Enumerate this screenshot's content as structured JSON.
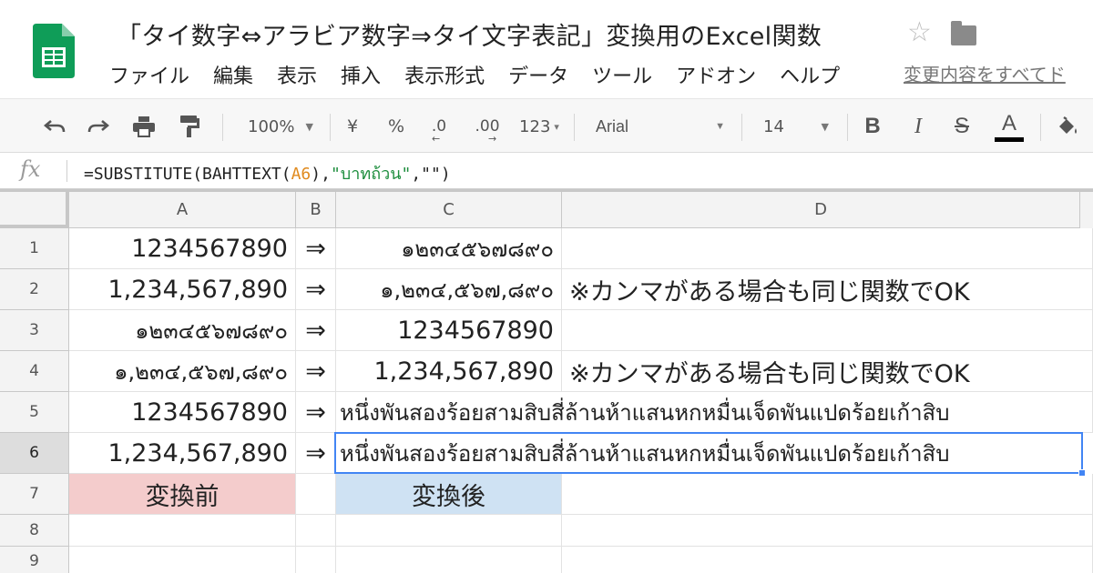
{
  "header": {
    "title": "「タイ数字⇔アラビア数字⇒タイ文字表記」変換用のExcel関数",
    "menu": [
      "ファイル",
      "編集",
      "表示",
      "挿入",
      "表示形式",
      "データ",
      "ツール",
      "アドオン",
      "ヘルプ"
    ],
    "last_edit": "変更内容をすべてド"
  },
  "toolbar": {
    "zoom": "100%",
    "currency": "¥",
    "percent": "%",
    "dec_decrease": ".0",
    "dec_increase": ".00",
    "number_format": "123",
    "font": "Arial",
    "font_size": "14",
    "bold": "B",
    "italic": "I",
    "strike": "S",
    "text_color": "A"
  },
  "formula_bar": {
    "fx": "fx",
    "prefix": "=SUBSTITUTE(BAHTTEXT(",
    "ref": "A6",
    "mid": "),",
    "str": "\"บาทถ้วน\"",
    "suffix": ",\"\")"
  },
  "columns": [
    "A",
    "B",
    "C",
    "D"
  ],
  "rows": [
    {
      "num": "1",
      "a": "1234567890",
      "b": "⇒",
      "c": "๑๒๓๔๕๖๗๘๙๐",
      "d": ""
    },
    {
      "num": "2",
      "a": "1,234,567,890",
      "b": "⇒",
      "c": "๑,๒๓๔,๕๖๗,๘๙๐",
      "d": "※カンマがある場合も同じ関数でOK"
    },
    {
      "num": "3",
      "a": "๑๒๓๔๕๖๗๘๙๐",
      "b": "⇒",
      "c": "1234567890",
      "d": ""
    },
    {
      "num": "4",
      "a": "๑,๒๓๔,๕๖๗,๘๙๐",
      "b": "⇒",
      "c": "1,234,567,890",
      "d": "※カンマがある場合も同じ関数でOK"
    },
    {
      "num": "5",
      "a": "1234567890",
      "b": "⇒",
      "c": "หนึ่งพันสองร้อยสามสิบสี่ล้านห้าแสนหกหมื่นเจ็ดพันแปดร้อยเก้าสิบ",
      "d": ""
    },
    {
      "num": "6",
      "a": "1,234,567,890",
      "b": "⇒",
      "c": "หนึ่งพันสองร้อยสามสิบสี่ล้านห้าแสนหกหมื่นเจ็ดพันแปดร้อยเก้าสิบ",
      "d": ""
    },
    {
      "num": "7",
      "a": "変換前",
      "b": "",
      "c": "変換後",
      "d": ""
    },
    {
      "num": "8",
      "a": "",
      "b": "",
      "c": "",
      "d": ""
    },
    {
      "num": "9",
      "a": "",
      "b": "",
      "c": "",
      "d": ""
    }
  ],
  "colors": {
    "before_fill": "#f4cccc",
    "after_fill": "#cfe2f3",
    "selection": "#4285f4",
    "sheets_green": "#0f9d58"
  }
}
